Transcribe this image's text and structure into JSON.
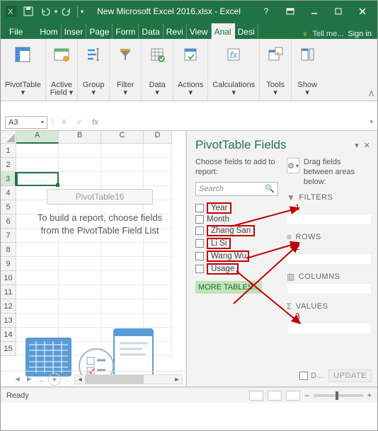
{
  "titlebar": {
    "title": "New Microsoft Excel 2016.xlsx - Excel"
  },
  "window_controls": {
    "help": "?",
    "min": "–",
    "max": "□",
    "close": "✕",
    "ribbon_min": "▢",
    "ribbon_close": "✕"
  },
  "tabs": {
    "file": "File",
    "items": [
      "Hom",
      "Inser",
      "Page",
      "Form",
      "Data",
      "Revi",
      "View",
      "Anal",
      "Desi"
    ],
    "active_index": 7,
    "tell_me": "Tell me...",
    "signin": "Sign in"
  },
  "ribbon": [
    {
      "label": "PivotTable\n▾"
    },
    {
      "label": "Active\nField ▾"
    },
    {
      "label": "Group\n▾"
    },
    {
      "label": "Filter\n▾"
    },
    {
      "label": "Data\n▾"
    },
    {
      "label": "Actions\n▾"
    },
    {
      "label": "Calculations\n▾"
    },
    {
      "label": "Tools\n▾"
    },
    {
      "label": "Show\n▾"
    }
  ],
  "namebox": {
    "value": "A3",
    "fx": "fx"
  },
  "columns": [
    "A",
    "B",
    "C",
    "D"
  ],
  "rows": [
    "1",
    "2",
    "3",
    "4",
    "5",
    "6",
    "7",
    "8",
    "9",
    "10",
    "11",
    "12",
    "13",
    "14",
    "15"
  ],
  "selected_cell": "A3",
  "pivot_overlay": {
    "name": "PivotTable16",
    "msg": "To build a report, choose fields from the PivotTable Field List"
  },
  "sheet_tabs": {
    "ellipsis": "...",
    "add": "+"
  },
  "fieldpane": {
    "title": "PivotTable Fields",
    "choose": "Choose fields to add to report:",
    "drag": "Drag fields between areas below:",
    "search_placeholder": "Search",
    "fields": [
      {
        "label": "Year",
        "boxed": true
      },
      {
        "label": "Month",
        "boxed": false
      },
      {
        "label": "Zhang San",
        "boxed": true
      },
      {
        "label": "Li Si",
        "boxed": true
      },
      {
        "label": "Wang Wu",
        "boxed": true
      },
      {
        "label": "Usage",
        "boxed": true
      }
    ],
    "more": "MORE TABLES...",
    "areas": {
      "filters": {
        "label": "FILTERS",
        "num": "1"
      },
      "rows": {
        "label": "ROWS",
        "num": "2"
      },
      "columns": {
        "label": "COLUMNS"
      },
      "values": {
        "label": "VALUES",
        "num": "3"
      }
    },
    "defer": "D...",
    "update": "UPDATE"
  },
  "status": {
    "ready": "Ready",
    "zoom": "+"
  }
}
